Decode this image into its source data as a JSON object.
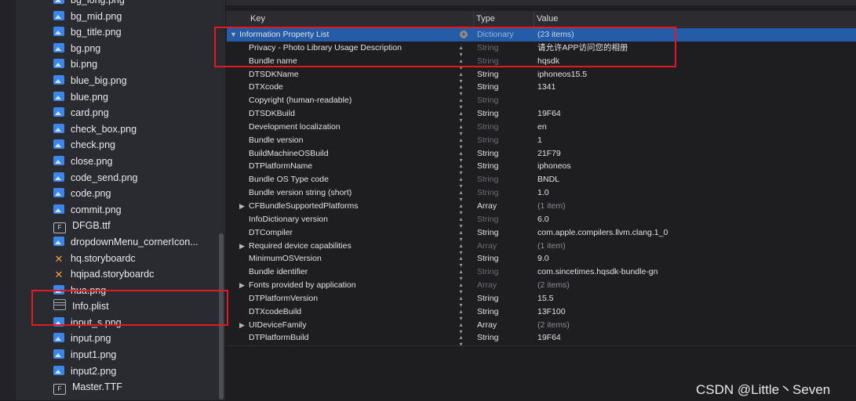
{
  "navigator": {
    "files": [
      {
        "name": "bg_long.png",
        "type": "png"
      },
      {
        "name": "bg_mid.png",
        "type": "png"
      },
      {
        "name": "bg_title.png",
        "type": "png"
      },
      {
        "name": "bg.png",
        "type": "png"
      },
      {
        "name": "bi.png",
        "type": "png"
      },
      {
        "name": "blue_big.png",
        "type": "png"
      },
      {
        "name": "blue.png",
        "type": "png"
      },
      {
        "name": "card.png",
        "type": "png"
      },
      {
        "name": "check_box.png",
        "type": "png"
      },
      {
        "name": "check.png",
        "type": "png"
      },
      {
        "name": "close.png",
        "type": "png"
      },
      {
        "name": "code_send.png",
        "type": "png"
      },
      {
        "name": "code.png",
        "type": "png"
      },
      {
        "name": "commit.png",
        "type": "png"
      },
      {
        "name": "DFGB.ttf",
        "type": "font"
      },
      {
        "name": "dropdownMenu_cornerIcon...",
        "type": "png"
      },
      {
        "name": "hq.storyboardc",
        "type": "storyboard"
      },
      {
        "name": "hqipad.storyboardc",
        "type": "storyboard"
      },
      {
        "name": "hua.png",
        "type": "png"
      },
      {
        "name": "Info.plist",
        "type": "plist",
        "selected": true
      },
      {
        "name": "input_s.png",
        "type": "png"
      },
      {
        "name": "input.png",
        "type": "png"
      },
      {
        "name": "input1.png",
        "type": "png"
      },
      {
        "name": "input2.png",
        "type": "png"
      },
      {
        "name": "Master.TTF",
        "type": "font"
      }
    ]
  },
  "editor": {
    "columns": {
      "key": "Key",
      "type": "Type",
      "value": "Value"
    },
    "root": {
      "key": "Information Property List",
      "type": "Dictionary",
      "value": "(23 items)"
    },
    "rows": [
      {
        "key": "Privacy - Photo Library Usage Description",
        "type": "String",
        "value": "请允许APP访问您的相册",
        "type_dim": true
      },
      {
        "key": "Bundle name",
        "type": "String",
        "value": "hqsdk",
        "type_dim": true
      },
      {
        "key": "DTSDKName",
        "type": "String",
        "value": "iphoneos15.5"
      },
      {
        "key": "DTXcode",
        "type": "String",
        "value": "1341"
      },
      {
        "key": "Copyright (human-readable)",
        "type": "String",
        "value": "",
        "type_dim": true
      },
      {
        "key": "DTSDKBuild",
        "type": "String",
        "value": "19F64"
      },
      {
        "key": "Development localization",
        "type": "String",
        "value": "en",
        "type_dim": true
      },
      {
        "key": "Bundle version",
        "type": "String",
        "value": "1",
        "type_dim": true
      },
      {
        "key": "BuildMachineOSBuild",
        "type": "String",
        "value": "21F79"
      },
      {
        "key": "DTPlatformName",
        "type": "String",
        "value": "iphoneos"
      },
      {
        "key": "Bundle OS Type code",
        "type": "String",
        "value": "BNDL",
        "type_dim": true
      },
      {
        "key": "Bundle version string (short)",
        "type": "String",
        "value": "1.0",
        "type_dim": true
      },
      {
        "key": "CFBundleSupportedPlatforms",
        "type": "Array",
        "value": "(1 item)",
        "expandable": true,
        "value_dim": true
      },
      {
        "key": "InfoDictionary version",
        "type": "String",
        "value": "6.0",
        "type_dim": true
      },
      {
        "key": "DTCompiler",
        "type": "String",
        "value": "com.apple.compilers.llvm.clang.1_0"
      },
      {
        "key": "Required device capabilities",
        "type": "Array",
        "value": "(1 item)",
        "expandable": true,
        "type_dim": true,
        "value_dim": true
      },
      {
        "key": "MinimumOSVersion",
        "type": "String",
        "value": "9.0"
      },
      {
        "key": "Bundle identifier",
        "type": "String",
        "value": "com.sincetimes.hqsdk-bundle-gn",
        "type_dim": true
      },
      {
        "key": "Fonts provided by application",
        "type": "Array",
        "value": "(2 items)",
        "expandable": true,
        "type_dim": true,
        "value_dim": true
      },
      {
        "key": "DTPlatformVersion",
        "type": "String",
        "value": "15.5"
      },
      {
        "key": "DTXcodeBuild",
        "type": "String",
        "value": "13F100"
      },
      {
        "key": "UIDeviceFamily",
        "type": "Array",
        "value": "(2 items)",
        "expandable": true,
        "value_dim": true
      },
      {
        "key": "DTPlatformBuild",
        "type": "String",
        "value": "19F64"
      }
    ]
  },
  "watermark": "CSDN @Little丶Seven",
  "colors": {
    "selection": "#245ca8",
    "annotation": "#e01b24",
    "nav_bg": "#2a2a31"
  }
}
